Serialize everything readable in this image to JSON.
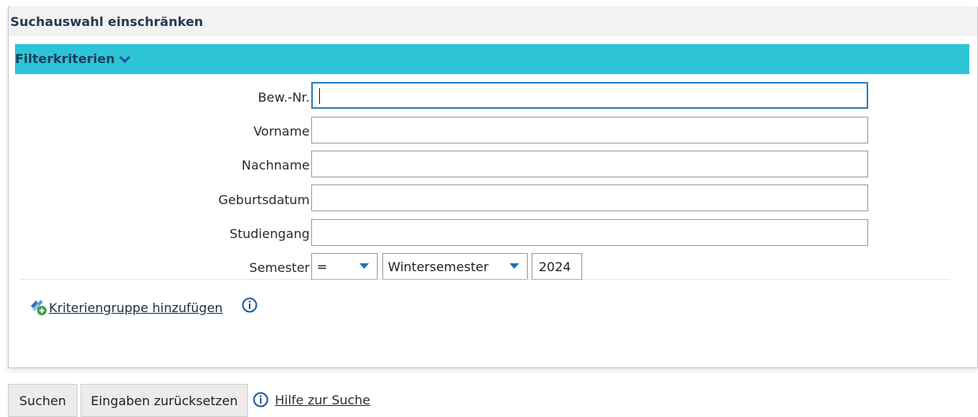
{
  "panel": {
    "title": "Suchauswahl einschränken",
    "filter_title": "Filterkriterien"
  },
  "form": {
    "fields": [
      {
        "label": "Bew.-Nr.",
        "value": ""
      },
      {
        "label": "Vorname",
        "value": ""
      },
      {
        "label": "Nachname",
        "value": ""
      },
      {
        "label": "Geburtsdatum",
        "value": ""
      },
      {
        "label": "Studiengang",
        "value": ""
      }
    ],
    "semester": {
      "label": "Semester",
      "operator": "=",
      "term": "Wintersemester",
      "year": "2024"
    }
  },
  "add_group": {
    "label": "Kriteriengruppe hinzufügen",
    "icon": "add-group-icon"
  },
  "buttons": {
    "search": "Suchen",
    "reset": "Eingaben zurücksetzen",
    "help": "Hilfe zur Suche"
  },
  "colors": {
    "filter_bar": "#2dc4d7",
    "title": "#233c54",
    "focus": "#2f7fbf",
    "icon_blue": "#1f6fb2"
  }
}
